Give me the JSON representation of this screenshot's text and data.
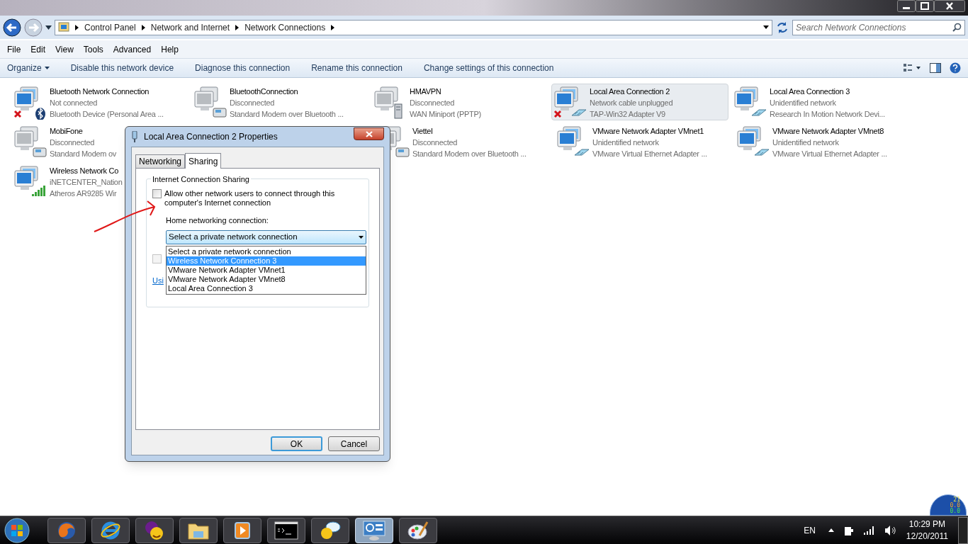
{
  "address_bar": {
    "breadcrumbs": [
      "Control Panel",
      "Network and Internet",
      "Network Connections"
    ],
    "search_placeholder": "Search Network Connections"
  },
  "menu": [
    "File",
    "Edit",
    "View",
    "Tools",
    "Advanced",
    "Help"
  ],
  "commands": [
    {
      "label": "Organize",
      "kind": "dropdown"
    },
    {
      "label": "Disable this network device",
      "kind": "plain"
    },
    {
      "label": "Diagnose this connection",
      "kind": "plain"
    },
    {
      "label": "Rename this connection",
      "kind": "plain"
    },
    {
      "label": "Change settings of this connection",
      "kind": "plain"
    }
  ],
  "connections": [
    [
      {
        "kind": "bluetooth",
        "name": "Bluetooth Network Connection",
        "status": "Not connected",
        "device": "Bluetooth Device (Personal Area ...",
        "connected": true,
        "failed": true,
        "selected": false
      },
      {
        "kind": "modem",
        "name": "BluetoothConnection",
        "status": "Disconnected",
        "device": "Standard Modem over Bluetooth ...",
        "connected": false,
        "failed": false,
        "selected": false
      },
      {
        "kind": "vpn",
        "name": "HMAVPN",
        "status": "Disconnected",
        "device": "WAN Miniport (PPTP)",
        "connected": false,
        "failed": false,
        "selected": false
      },
      {
        "kind": "ethernet",
        "name": "Local Area Connection 2",
        "status": "Network cable unplugged",
        "device": "TAP-Win32 Adapter V9",
        "connected": true,
        "failed": true,
        "selected": true
      },
      {
        "kind": "ethernet",
        "name": "Local Area Connection 3",
        "status": "Unidentified network",
        "device": "Research In Motion Network Devi...",
        "connected": true,
        "failed": false,
        "selected": false
      }
    ],
    [
      {
        "kind": "modem",
        "name": "MobiFone",
        "status": "Disconnected",
        "device": "Standard Modem ov",
        "connected": false,
        "failed": false,
        "selected": false
      },
      {
        "kind": "covered"
      },
      {
        "kind": "modem",
        "name": "Viettel",
        "status": "Disconnected",
        "device": "Standard Modem over Bluetooth ...",
        "connected": false,
        "selected": false
      },
      {
        "kind": "ethernet",
        "name": "VMware Network Adapter VMnet1",
        "status": "Unidentified network",
        "device": "VMware Virtual Ethernet Adapter ...",
        "connected": true,
        "failed": false,
        "selected": false
      },
      {
        "kind": "ethernet",
        "name": "VMware Network Adapter VMnet8",
        "status": "Unidentified network",
        "device": "VMware Virtual Ethernet Adapter ...",
        "connected": true,
        "failed": false,
        "selected": false
      }
    ],
    [
      {
        "kind": "wifi",
        "name": "Wireless Network Co",
        "status": "iNETCENTER_Nation",
        "device": "Atheros AR9285 Wir",
        "connected": true,
        "failed": false,
        "selected": false
      }
    ]
  ],
  "dialog": {
    "title": "Local Area Connection 2 Properties",
    "tabs": [
      {
        "label": "Networking",
        "selected": false
      },
      {
        "label": "Sharing",
        "selected": true
      }
    ],
    "group_title": "Internet Connection Sharing",
    "allow_checkbox": {
      "label": "Allow other network users to connect through this computer's Internet connection",
      "checked": false
    },
    "home_label": "Home networking connection:",
    "select_value": "Select a private network connection",
    "options": [
      {
        "label": "Select a private network connection",
        "selected": false
      },
      {
        "label": "Wireless Network Connection 3",
        "selected": true
      },
      {
        "label": "VMware Network Adapter VMnet1",
        "selected": false
      },
      {
        "label": "VMware Network Adapter VMnet8",
        "selected": false
      },
      {
        "label": "Local Area Connection 3",
        "selected": false
      }
    ],
    "control_checkbox": {
      "checked": false,
      "disabled": true
    },
    "link": "Usi",
    "buttons": [
      {
        "label": "OK",
        "default": true
      },
      {
        "label": "Cancel",
        "default": false
      }
    ]
  },
  "gadget": {
    "count": "21",
    "down": "0.0",
    "up": "0.0"
  },
  "taskbar": {
    "apps": [
      {
        "kind": "firefox",
        "active": false
      },
      {
        "kind": "ie",
        "active": false
      },
      {
        "kind": "messenger",
        "active": false
      },
      {
        "kind": "folder",
        "active": false
      },
      {
        "kind": "media",
        "active": false
      },
      {
        "kind": "console",
        "active": false
      },
      {
        "kind": "chat",
        "active": false
      },
      {
        "kind": "control",
        "active": true
      },
      {
        "kind": "paint",
        "active": false
      }
    ],
    "language": "EN",
    "time": "10:29 PM",
    "date": "12/20/2011"
  }
}
